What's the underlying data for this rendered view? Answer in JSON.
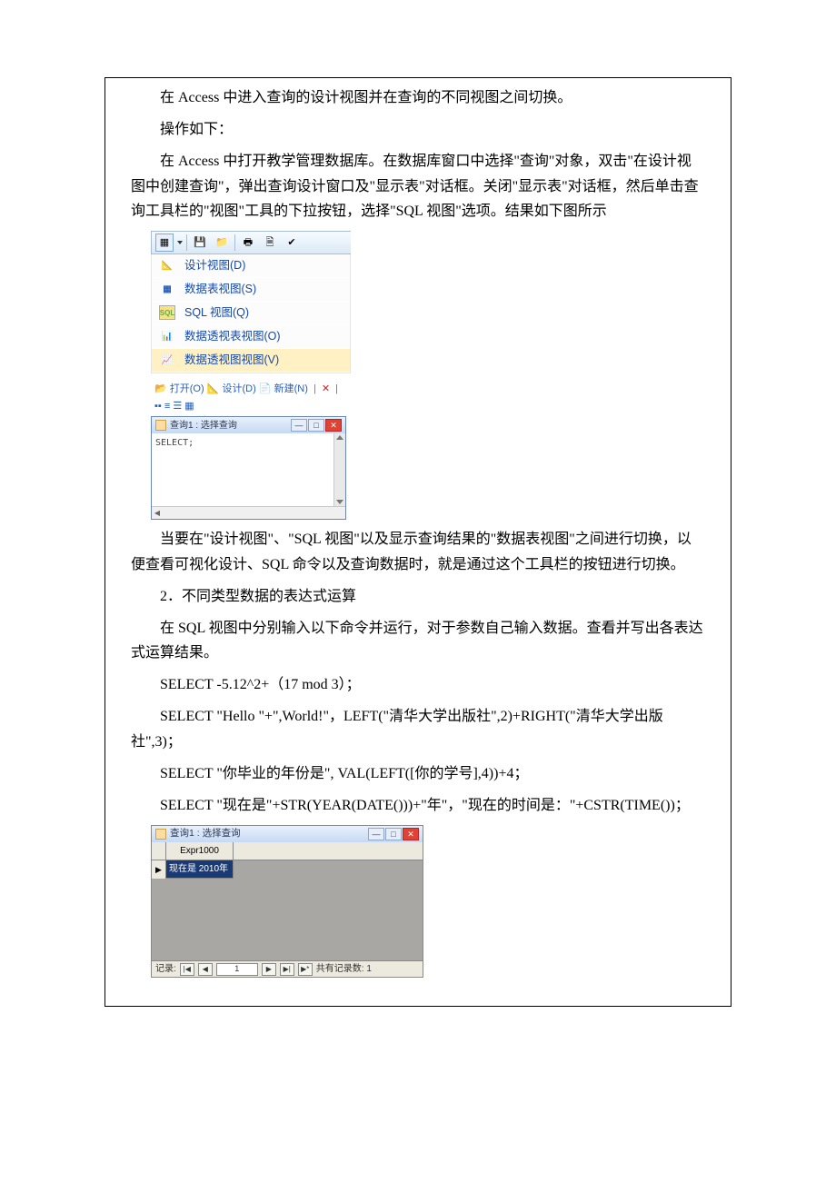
{
  "paragraphs": {
    "p1": "在 Access 中进入查询的设计视图并在查询的不同视图之间切换。",
    "p2": "操作如下：",
    "p3": "在 Access 中打开教学管理数据库。在数据库窗口中选择\"查询\"对象，双击\"在设计视图中创建查询\"，弹出查询设计窗口及\"显示表\"对话框。关闭\"显示表\"对话框，然后单击查询工具栏的\"视图\"工具的下拉按钮，选择\"SQL 视图\"选项。结果如下图所示",
    "p4": "当要在\"设计视图\"、\"SQL 视图\"以及显示查询结果的\"数据表视图\"之间进行切换，以便查看可视化设计、SQL 命令以及查询数据时，就是通过这个工具栏的按钮进行切换。",
    "p5": "2．不同类型数据的表达式运算",
    "p6": "在 SQL 视图中分别输入以下命令并运行，对于参数自己输入数据。查看并写出各表达式运算结果。",
    "stmt1": "SELECT -5.12^2+（17 mod 3）；",
    "stmt2": "SELECT \"Hello \"+\",World!\"，LEFT(\"清华大学出版社\",2)+RIGHT(\"清华大学出版社\",3)；",
    "stmt3": "SELECT \"你毕业的年份是\", VAL(LEFT([你的学号],4))+4；",
    "stmt4": "SELECT \"现在是\"+STR(YEAR(DATE()))+\"年\"，\"现在的时间是：\"+CSTR(TIME())；"
  },
  "toolbar": {
    "icons": {
      "gridview": "▦",
      "save": "💾",
      "folder": "📁",
      "print": "🖶",
      "preview": "🗎",
      "spell": "✔"
    }
  },
  "view_menu": {
    "design": "设计视图(D)",
    "datasheet": "数据表视图(S)",
    "sql": "SQL 视图(Q)",
    "pivottable": "数据透视表视图(O)",
    "pivotchart": "数据透视图视图(V)",
    "sql_icon_text": "SQL"
  },
  "db_toolbar": {
    "open": "打开(O)",
    "design": "设计(D)",
    "new": "新建(N)"
  },
  "query_window": {
    "title": "查询1 : 选择查询",
    "body": "SELECT;"
  },
  "datasheet": {
    "title": "查询1 : 选择查询",
    "col1": "Expr1000",
    "cell1": "现在是 2010年",
    "nav_label": "记录:",
    "nav_value": "1",
    "nav_total": "共有记录数: 1",
    "first": "|◀",
    "prev": "◀",
    "next": "▶",
    "last": "▶|",
    "new": "▶*",
    "row_marker": "▶"
  }
}
